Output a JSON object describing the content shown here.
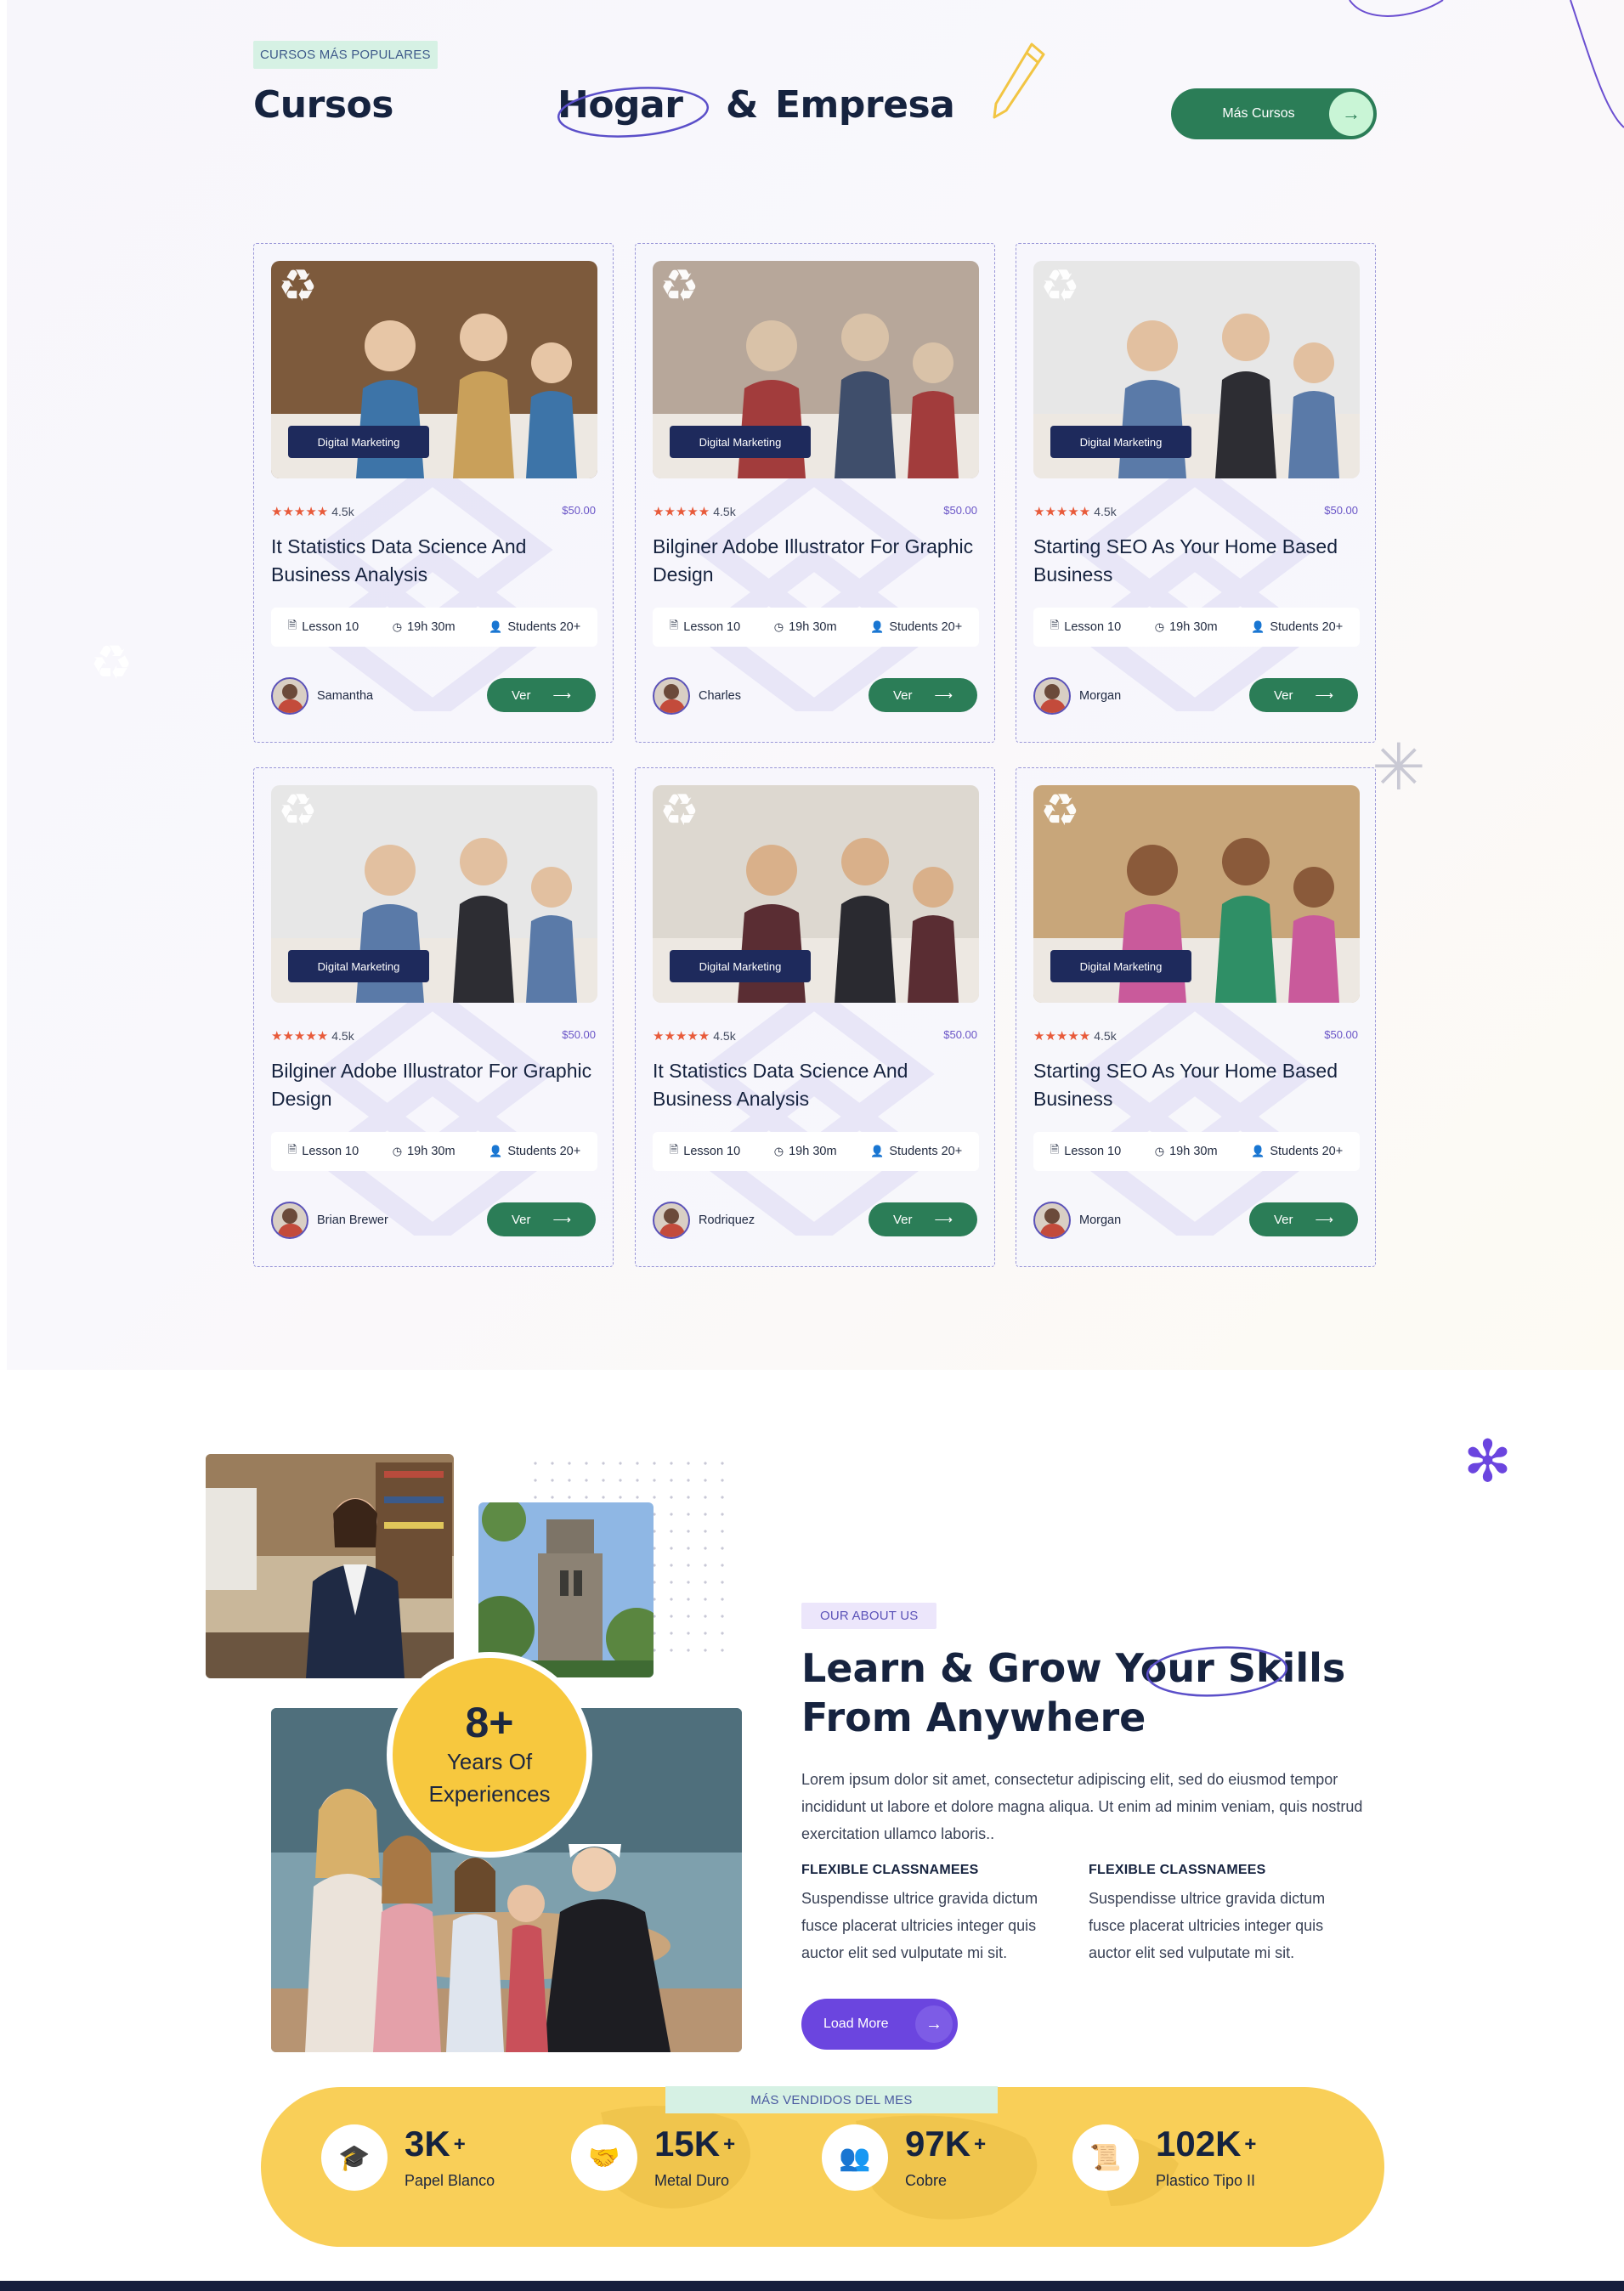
{
  "courses_section": {
    "badge": "CURSOS MÁS POPULARES",
    "title_word1": "Cursos",
    "title_word2": "Hogar",
    "title_amp": "&",
    "title_word3": "Empresa",
    "more_button": "Más Cursos",
    "cards": [
      {
        "category": "Digital Marketing",
        "rating": "4.5k",
        "price": "$50.00",
        "title": "It Statistics Data Science And Business Analysis",
        "lessons": "Lesson 10",
        "duration": "19h 30m",
        "students": "Students 20+",
        "author": "Samantha",
        "button": "Ver"
      },
      {
        "category": "Digital Marketing",
        "rating": "4.5k",
        "price": "$50.00",
        "title": "Bilginer Adobe Illustrator For Graphic Design",
        "lessons": "Lesson 10",
        "duration": "19h 30m",
        "students": "Students 20+",
        "author": "Charles",
        "button": "Ver"
      },
      {
        "category": "Digital Marketing",
        "rating": "4.5k",
        "price": "$50.00",
        "title": "Starting SEO As Your Home Based Business",
        "lessons": "Lesson 10",
        "duration": "19h 30m",
        "students": "Students 20+",
        "author": "Morgan",
        "button": "Ver"
      },
      {
        "category": "Digital Marketing",
        "rating": "4.5k",
        "price": "$50.00",
        "title": "Bilginer Adobe Illustrator For Graphic Design",
        "lessons": "Lesson 10",
        "duration": "19h 30m",
        "students": "Students 20+",
        "author": "Brian Brewer",
        "button": "Ver"
      },
      {
        "category": "Digital Marketing",
        "rating": "4.5k",
        "price": "$50.00",
        "title": "It Statistics Data Science And Business Analysis",
        "lessons": "Lesson 10",
        "duration": "19h 30m",
        "students": "Students 20+",
        "author": "Rodriquez",
        "button": "Ver"
      },
      {
        "category": "Digital Marketing",
        "rating": "4.5k",
        "price": "$50.00",
        "title": "Starting SEO As Your Home Based Business",
        "lessons": "Lesson 10",
        "duration": "19h 30m",
        "students": "Students 20+",
        "author": "Morgan",
        "button": "Ver"
      }
    ]
  },
  "about": {
    "badge": "OUR ABOUT US",
    "title_line1_a": "Learn & Grow Your ",
    "title_line1_b": "Skills",
    "title_line2": "From Anywhere",
    "paragraph": "Lorem ipsum dolor sit amet, consectetur adipiscing elit, sed do eiusmod tempor incididunt ut labore et dolore magna aliqua. Ut enim ad minim veniam, quis nostrud exercitation ullamco laboris..",
    "features": [
      {
        "heading": "FLEXIBLE CLASSNAMEES",
        "text": "Suspendisse ultrice gravida dictum fusce placerat ultricies integer quis auctor elit sed vulputate mi sit."
      },
      {
        "heading": "FLEXIBLE CLASSNAMEES",
        "text": "Suspendisse ultrice gravida dictum fusce placerat ultricies integer quis auctor elit sed vulputate mi sit."
      }
    ],
    "load_button": "Load More",
    "experience_number": "8+",
    "experience_text": "Years Of Experiences"
  },
  "stats": {
    "badge": "MÁS VENDIDOS DEL MES",
    "items": [
      {
        "value": "3K",
        "suffix": "+",
        "label": "Papel Blanco",
        "icon": "graduate-icon"
      },
      {
        "value": "15K",
        "suffix": "+",
        "label": "Metal Duro",
        "icon": "handshake-icon"
      },
      {
        "value": "97K",
        "suffix": "+",
        "label": "Cobre",
        "icon": "team-icon"
      },
      {
        "value": "102K",
        "suffix": "+",
        "label": "Plastico Tipo II",
        "icon": "certificate-icon"
      }
    ]
  },
  "colors": {
    "accent_green": "#2b7d57",
    "accent_purple": "#6b45df",
    "stats_yellow": "#f9cf58",
    "navy": "#16233f"
  }
}
